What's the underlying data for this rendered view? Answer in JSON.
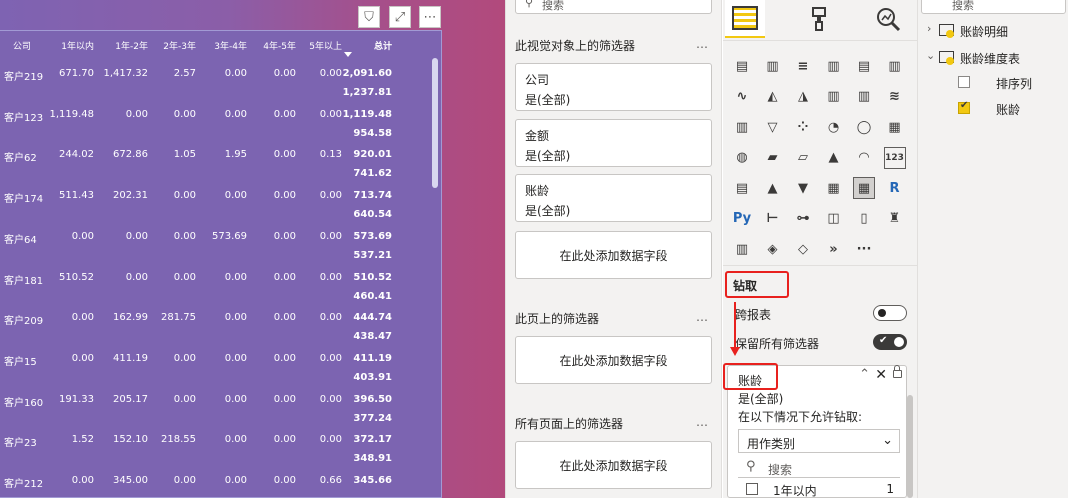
{
  "canvas": {
    "buttons": {
      "filter_icon": "⛉",
      "focus_icon": "⤢",
      "more_icon": "⋯"
    },
    "columns": [
      "公司",
      "1年以内",
      "1年-2年",
      "2年-3年",
      "3年-4年",
      "4年-5年",
      "5年以上",
      "总计"
    ],
    "rows": [
      [
        "客户219",
        "671.70",
        "1,417.32",
        "2.57",
        "0.00",
        "0.00",
        "0.00",
        "2,091.60",
        "1,237.81"
      ],
      [
        "客户123",
        "1,119.48",
        "0.00",
        "0.00",
        "0.00",
        "0.00",
        "0.00",
        "1,119.48",
        "954.58"
      ],
      [
        "客户62",
        "244.02",
        "672.86",
        "1.05",
        "1.95",
        "0.00",
        "0.13",
        "920.01",
        "741.62"
      ],
      [
        "客户174",
        "511.43",
        "202.31",
        "0.00",
        "0.00",
        "0.00",
        "0.00",
        "713.74",
        "640.54"
      ],
      [
        "客户64",
        "0.00",
        "0.00",
        "0.00",
        "573.69",
        "0.00",
        "0.00",
        "573.69",
        "537.21"
      ],
      [
        "客户181",
        "510.52",
        "0.00",
        "0.00",
        "0.00",
        "0.00",
        "0.00",
        "510.52",
        "460.41"
      ],
      [
        "客户209",
        "0.00",
        "162.99",
        "281.75",
        "0.00",
        "0.00",
        "0.00",
        "444.74",
        "438.47"
      ],
      [
        "客户15",
        "0.00",
        "411.19",
        "0.00",
        "0.00",
        "0.00",
        "0.00",
        "411.19",
        "403.91"
      ],
      [
        "客户160",
        "191.33",
        "205.17",
        "0.00",
        "0.00",
        "0.00",
        "0.00",
        "396.50",
        "377.24"
      ],
      [
        "客户23",
        "1.52",
        "152.10",
        "218.55",
        "0.00",
        "0.00",
        "0.00",
        "372.17",
        "348.91"
      ],
      [
        "客户212",
        "0.00",
        "345.00",
        "0.00",
        "0.00",
        "0.00",
        "0.66",
        "345.66",
        ""
      ]
    ]
  },
  "filters": {
    "search_label": "搜索",
    "visual_section": "此视觉对象上的筛选器",
    "page_section": "此页上的筛选器",
    "all_pages_section": "所有页面上的筛选器",
    "more": "…",
    "cards": [
      {
        "name": "公司",
        "value": "是(全部)"
      },
      {
        "name": "金额",
        "value": "是(全部)"
      },
      {
        "name": "账龄",
        "value": "是(全部)"
      }
    ],
    "add_field": "在此处添加数据字段"
  },
  "viz": {
    "drill_title": "钻取",
    "cross_report": "跨报表",
    "keep_filters": "保留所有筛选器",
    "field_name": "账龄",
    "field_value": "是(全部)",
    "allow_drill": "在以下情况下允许钻取:",
    "dropdown_value": "用作类别",
    "search_placeholder": "搜索",
    "list_item": "1年以内",
    "list_count": "1",
    "r_label": "R",
    "py_label": "Py",
    "more_visuals": "···",
    "kpi_label": "123"
  },
  "fields": {
    "search_label": "搜索",
    "table1": "账龄明细",
    "table2": "账龄维度表",
    "field1": "排序列",
    "field2": "账龄"
  },
  "colors": {
    "accent": "#f2c811",
    "red_annotation": "#e8211e",
    "canvas_visual": "#7c64b1"
  }
}
